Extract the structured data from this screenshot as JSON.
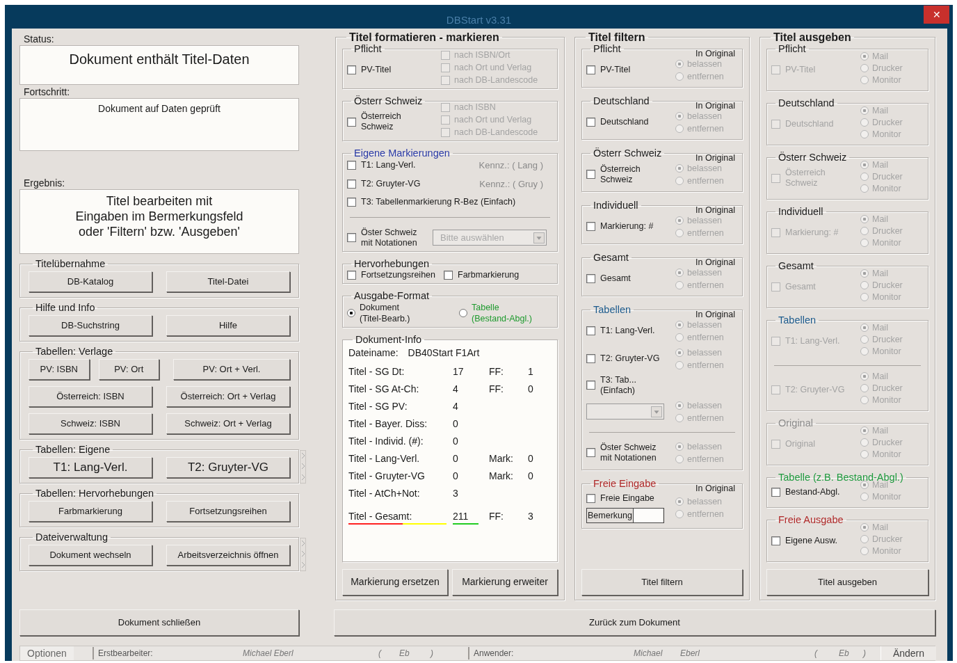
{
  "window": {
    "title": "DBStart v3.31",
    "close": "✕"
  },
  "left": {
    "status": {
      "label": "Status:",
      "text": "Dokument enthält Titel-Daten"
    },
    "progress": {
      "label": "Fortschritt:",
      "text": "Dokument auf Daten geprüft"
    },
    "result": {
      "label": "Ergebnis:",
      "lines": [
        "Titel bearbeiten mit",
        "Eingaben im Bermerkungsfeld",
        "oder 'Filtern' bzw. 'Ausgeben'"
      ]
    },
    "groups": [
      {
        "title": "Titelübernahme",
        "kind": "normal",
        "side_strip": false,
        "buttons": [
          [
            "DB-Katalog",
            "Titel-Datei"
          ]
        ]
      },
      {
        "title": "Hilfe und Info",
        "kind": "normal",
        "side_strip": false,
        "buttons": [
          [
            "DB-Suchstring",
            "Hilfe"
          ]
        ]
      },
      {
        "title": "Tabellen: Verlage",
        "kind": "normal",
        "side_strip": false,
        "buttons": [
          [
            "PV: ISBN",
            "PV: Ort",
            "PV: Ort + Verl."
          ],
          [
            "Österreich: ISBN",
            "Österreich: Ort + Verlag"
          ],
          [
            "Schweiz: ISBN",
            "Schweiz: Ort + Verlag"
          ]
        ]
      },
      {
        "title": "Tabellen: Eigene",
        "kind": "large",
        "side_strip": true,
        "buttons": [
          [
            "T1: Lang-Verl.",
            "T2: Gruyter-VG"
          ]
        ]
      },
      {
        "title": "Tabellen: Hervorhebungen",
        "kind": "normal",
        "side_strip": false,
        "buttons": [
          [
            "Farbmarkierung",
            "Fortsetzungsreihen"
          ]
        ]
      },
      {
        "title": "Dateiverwaltung",
        "kind": "normal",
        "side_strip": true,
        "buttons": [
          [
            "Dokument wechseln",
            "Arbeitsverzeichnis öffnen"
          ]
        ]
      }
    ],
    "close_button": "Dokument schließen"
  },
  "middle": {
    "title": "Titel formatieren - markieren",
    "groups": [
      {
        "kind": "stack",
        "title": "Pflicht",
        "color": "#1a1a1a",
        "items": [
          {
            "kind": "check",
            "label": "PV-Titel",
            "checked": false,
            "disabled": false,
            "subs": [
              {
                "label": "nach ISBN/Ort",
                "checked": false,
                "disabled": true
              },
              {
                "label": "nach Ort und Verlag",
                "checked": false,
                "disabled": true
              },
              {
                "label": "nach DB-Landescode",
                "checked": false,
                "disabled": true
              }
            ]
          }
        ]
      },
      {
        "kind": "stack",
        "title": "Österr Schweiz",
        "color": "#1a1a1a",
        "items": [
          {
            "kind": "check",
            "label": "Österreich Schweiz",
            "checked": false,
            "disabled": false,
            "subs": [
              {
                "label": "nach ISBN",
                "checked": false,
                "disabled": true
              },
              {
                "label": "nach Ort und Verlag",
                "checked": false,
                "disabled": true
              },
              {
                "label": "nach DB-Landescode",
                "checked": false,
                "disabled": true
              }
            ]
          }
        ]
      },
      {
        "kind": "stack",
        "title": "Eigene Markierungen",
        "color": "#2a3aa6",
        "items": [
          {
            "kind": "check",
            "label": "T1: Lang-Verl.",
            "checked": false,
            "disabled": false,
            "note": "Kennz.: ( Lang )"
          },
          {
            "kind": "check",
            "label": "T2: Gruyter-VG",
            "checked": false,
            "disabled": false,
            "note": "Kennz.: ( Gruy )"
          },
          {
            "kind": "check",
            "label": "T3: Tabellenmarkierung R-Bez (Einfach)",
            "checked": false,
            "disabled": false
          },
          {
            "kind": "divider"
          },
          {
            "kind": "check",
            "label": "Öster Schweiz mit Notationen",
            "checked": false,
            "disabled": false,
            "combo": {
              "placeholder": "Bitte auswählen",
              "disabled": true
            }
          }
        ]
      },
      {
        "kind": "row",
        "title": "Hervorhebungen",
        "color": "#1a1a1a",
        "items": [
          {
            "kind": "check",
            "label": "Fortsetzungsreihen",
            "checked": false,
            "disabled": false
          },
          {
            "kind": "check",
            "label": "Farbmarkierung",
            "checked": false,
            "disabled": false
          }
        ]
      },
      {
        "kind": "row",
        "title": "Ausgabe-Format",
        "color": "#1a1a1a",
        "items": [
          {
            "kind": "radio",
            "label": "Dokument (Titel-Bearb.)",
            "selected": true,
            "color": "#1a1a1a"
          },
          {
            "kind": "radio",
            "label": "Tabelle (Bestand-Abgl.)",
            "selected": false,
            "color": "#1e9a2e"
          }
        ]
      },
      {
        "kind": "info",
        "title": "Dokument-Info",
        "color": "#1a1a1a",
        "file_label": "Dateiname:",
        "file": "DB40Start F1Art",
        "rows": [
          {
            "kind": "count",
            "label": "Titel - SG Dt:",
            "value": "17",
            "extra_label": "FF:",
            "extra_value": "1"
          },
          {
            "kind": "count",
            "label": "Titel - SG At-Ch:",
            "value": "4",
            "extra_label": "FF:",
            "extra_value": "0"
          },
          {
            "kind": "count",
            "label": "Titel - SG PV:",
            "value": "4"
          },
          {
            "kind": "count",
            "label": "Titel - Bayer. Diss:",
            "value": "0"
          },
          {
            "kind": "count",
            "label": "Titel - Individ. (#):",
            "value": "0"
          },
          {
            "kind": "count",
            "label": "Titel - Lang-Verl.",
            "value": "0",
            "extra_label": "Mark:",
            "extra_value": "0"
          },
          {
            "kind": "count",
            "label": "Titel - Gruyter-VG",
            "value": "0",
            "extra_label": "Mark:",
            "extra_value": "0"
          },
          {
            "kind": "count",
            "label": "Titel - AtCh+Not:",
            "value": "3"
          },
          {
            "kind": "total",
            "label": "Titel - Gesamt:",
            "value": "211",
            "extra_label": "FF:",
            "extra_value": "3"
          }
        ]
      }
    ],
    "buttons": [
      "Markierung ersetzen",
      "Markierung erweiter"
    ]
  },
  "filter": {
    "title": "Titel filtern",
    "options_disabled": true,
    "groups": [
      {
        "title": "Pflicht",
        "color": "#1a1a1a",
        "header": "In Original",
        "items": [
          {
            "kind": "check",
            "label": "PV-Titel",
            "checked": false,
            "disabled": false,
            "options": [
              {
                "label": "belassen",
                "selected": true
              },
              {
                "label": "entfernen",
                "selected": false
              }
            ]
          }
        ]
      },
      {
        "title": "Deutschland",
        "color": "#1a1a1a",
        "header": "In Original",
        "items": [
          {
            "kind": "check",
            "label": "Deutschland",
            "checked": false,
            "disabled": false,
            "options": [
              {
                "label": "belassen",
                "selected": true
              },
              {
                "label": "entfernen",
                "selected": false
              }
            ]
          }
        ]
      },
      {
        "title": "Österr Schweiz",
        "color": "#1a1a1a",
        "header": "In Original",
        "items": [
          {
            "kind": "check",
            "label": "Österreich Schweiz",
            "checked": false,
            "disabled": false,
            "options": [
              {
                "label": "belassen",
                "selected": true
              },
              {
                "label": "entfernen",
                "selected": false
              }
            ]
          }
        ]
      },
      {
        "title": "Individuell",
        "color": "#1a1a1a",
        "header": "In Original",
        "items": [
          {
            "kind": "check",
            "label": "Markierung: #",
            "checked": false,
            "disabled": false,
            "options": [
              {
                "label": "belassen",
                "selected": true
              },
              {
                "label": "entfernen",
                "selected": false
              }
            ]
          }
        ]
      },
      {
        "title": "Gesamt",
        "color": "#1a1a1a",
        "header": "In Original",
        "items": [
          {
            "kind": "check",
            "label": "Gesamt",
            "checked": false,
            "disabled": false,
            "options": [
              {
                "label": "belassen",
                "selected": true
              },
              {
                "label": "entfernen",
                "selected": false
              }
            ]
          }
        ]
      },
      {
        "title": "Tabellen",
        "color": "#1c5a8c",
        "header": "In Original",
        "items": [
          {
            "kind": "check",
            "label": "T1: Lang-Verl.",
            "checked": false,
            "disabled": false,
            "options": [
              {
                "label": "belassen",
                "selected": true
              },
              {
                "label": "entfernen",
                "selected": false
              }
            ]
          },
          {
            "kind": "check",
            "label": "T2: Gruyter-VG",
            "checked": false,
            "disabled": false,
            "options": [
              {
                "label": "belassen",
                "selected": true
              },
              {
                "label": "entfernen",
                "selected": false
              }
            ]
          },
          {
            "kind": "check",
            "label": "T3: Tab... (Einfach)",
            "checked": false,
            "disabled": false
          },
          {
            "kind": "combo",
            "disabled": true,
            "options": [
              {
                "label": "belassen",
                "selected": true
              },
              {
                "label": "entfernen",
                "selected": false
              }
            ]
          },
          {
            "kind": "divider"
          },
          {
            "kind": "check",
            "label": "Öster Schweiz mit Notationen",
            "checked": false,
            "disabled": false,
            "options": [
              {
                "label": "belassen",
                "selected": true
              },
              {
                "label": "entfernen",
                "selected": false
              }
            ]
          }
        ]
      },
      {
        "title": "Freie Eingabe",
        "color": "#b02a2a",
        "header": "In Original",
        "items": [
          {
            "kind": "check",
            "label": "Freie Eingabe",
            "checked": false,
            "disabled": false,
            "field": {
              "label": "Bemerkung"
            },
            "options": [
              {
                "label": "belassen",
                "selected": true
              },
              {
                "label": "entfernen",
                "selected": false
              }
            ]
          }
        ]
      }
    ],
    "button": "Titel filtern"
  },
  "output": {
    "title": "Titel ausgeben",
    "options_disabled": true,
    "groups": [
      {
        "title": "Pflicht",
        "color": "#1a1a1a",
        "items": [
          {
            "kind": "check",
            "label": "PV-Titel",
            "checked": false,
            "disabled": true,
            "options": [
              {
                "label": "Mail",
                "selected": true
              },
              {
                "label": "Drucker",
                "selected": false
              },
              {
                "label": "Monitor",
                "selected": false
              }
            ]
          }
        ]
      },
      {
        "title": "Deutschland",
        "color": "#1a1a1a",
        "items": [
          {
            "kind": "check",
            "label": "Deutschland",
            "checked": false,
            "disabled": true,
            "options": [
              {
                "label": "Mail",
                "selected": true
              },
              {
                "label": "Drucker",
                "selected": false
              },
              {
                "label": "Monitor",
                "selected": false
              }
            ]
          }
        ]
      },
      {
        "title": "Österr Schweiz",
        "color": "#1a1a1a",
        "items": [
          {
            "kind": "check",
            "label": "Österreich Schweiz",
            "checked": false,
            "disabled": true,
            "options": [
              {
                "label": "Mail",
                "selected": true
              },
              {
                "label": "Drucker",
                "selected": false
              },
              {
                "label": "Monitor",
                "selected": false
              }
            ]
          }
        ]
      },
      {
        "title": "Individuell",
        "color": "#1a1a1a",
        "items": [
          {
            "kind": "check",
            "label": "Markierung: #",
            "checked": false,
            "disabled": true,
            "options": [
              {
                "label": "Mail",
                "selected": true
              },
              {
                "label": "Drucker",
                "selected": false
              },
              {
                "label": "Monitor",
                "selected": false
              }
            ]
          }
        ]
      },
      {
        "title": "Gesamt",
        "color": "#1a1a1a",
        "items": [
          {
            "kind": "check",
            "label": "Gesamt",
            "checked": false,
            "disabled": true,
            "options": [
              {
                "label": "Mail",
                "selected": true
              },
              {
                "label": "Drucker",
                "selected": false
              },
              {
                "label": "Monitor",
                "selected": false
              }
            ]
          }
        ]
      },
      {
        "title": "Tabellen",
        "color": "#1c5a8c",
        "items": [
          {
            "kind": "check",
            "label": "T1: Lang-Verl.",
            "checked": false,
            "disabled": true,
            "options": [
              {
                "label": "Mail",
                "selected": true
              },
              {
                "label": "Drucker",
                "selected": false
              },
              {
                "label": "Monitor",
                "selected": false
              }
            ]
          },
          {
            "kind": "divider"
          },
          {
            "kind": "check",
            "label": "T2: Gruyter-VG",
            "checked": false,
            "disabled": true,
            "options": [
              {
                "label": "Mail",
                "selected": true
              },
              {
                "label": "Drucker",
                "selected": false
              },
              {
                "label": "Monitor",
                "selected": false
              }
            ]
          }
        ]
      },
      {
        "title": "Original",
        "color": "#8c8c8c",
        "items": [
          {
            "kind": "check",
            "label": "Original",
            "checked": false,
            "disabled": true,
            "options": [
              {
                "label": "Mail",
                "selected": true
              },
              {
                "label": "Drucker",
                "selected": false
              },
              {
                "label": "Monitor",
                "selected": false
              }
            ]
          }
        ]
      },
      {
        "title": "Tabelle (z.B. Bestand-Abgl.)",
        "color": "#1e9a3e",
        "items": [
          {
            "kind": "check",
            "label": "Bestand-Abgl.",
            "checked": false,
            "disabled": false,
            "options": [
              {
                "label": "Mail",
                "selected": true
              },
              {
                "label": "Monitor",
                "selected": false
              }
            ]
          }
        ]
      },
      {
        "title": "Freie Ausgabe",
        "color": "#b02a2a",
        "items": [
          {
            "kind": "check",
            "label": "Eigene Ausw.",
            "checked": false,
            "disabled": false,
            "options": [
              {
                "label": "Mail",
                "selected": true
              },
              {
                "label": "Drucker",
                "selected": false
              },
              {
                "label": "Monitor",
                "selected": false
              }
            ]
          }
        ]
      }
    ],
    "button": "Titel ausgeben"
  },
  "back_button": "Zurück zum Dokument",
  "status_bar": {
    "options_button": "Optionen",
    "creator": {
      "label": "Erstbearbeiter:",
      "name": "Michael Eberl",
      "open": "(",
      "initials": "Eb",
      "close": ")"
    },
    "user": {
      "label": "Anwender:",
      "first": "Michael",
      "last": "Eberl",
      "open": "(",
      "initials": "Eb",
      "close": ")"
    },
    "change_button": "Ändern"
  }
}
